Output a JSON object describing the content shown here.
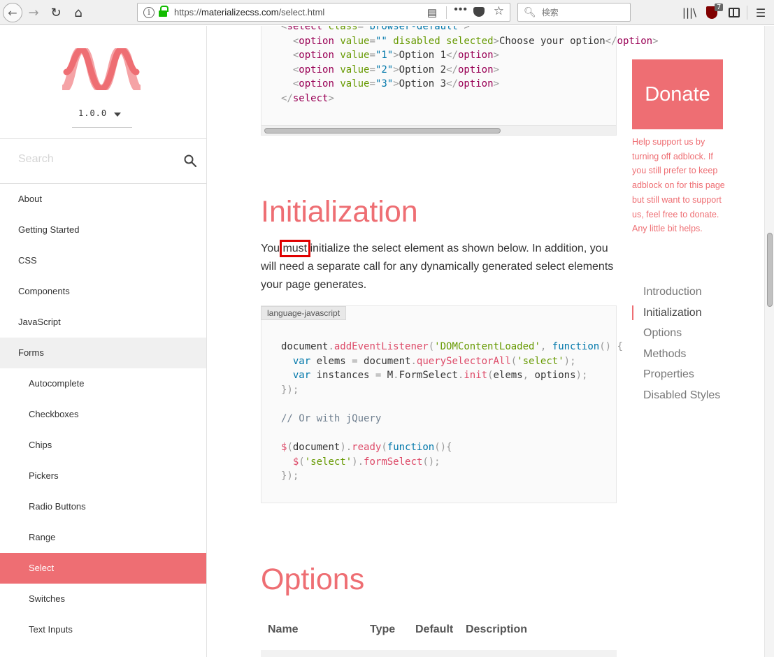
{
  "browser": {
    "url_prefix": "https://",
    "url_host": "materializecss.com",
    "url_path": "/select.html",
    "search_placeholder": "検索",
    "ublock_count": "7",
    "icons": [
      "back-arrow-icon",
      "forward-arrow-icon",
      "reload-icon",
      "home-icon",
      "info-icon",
      "lock-icon",
      "reader-view-icon",
      "more-dots-icon",
      "pocket-icon",
      "bookmark-star-icon",
      "search-icon",
      "library-icon",
      "ublock-shield-icon",
      "sidebar-icon",
      "hamburger-menu-icon"
    ]
  },
  "sidebar": {
    "version": "1.0.0",
    "search_placeholder": "Search",
    "items": [
      {
        "label": "About"
      },
      {
        "label": "Getting Started"
      },
      {
        "label": "CSS"
      },
      {
        "label": "Components"
      },
      {
        "label": "JavaScript"
      },
      {
        "label": "Forms"
      }
    ],
    "forms_sub": [
      {
        "label": "Autocomplete"
      },
      {
        "label": "Checkboxes"
      },
      {
        "label": "Chips"
      },
      {
        "label": "Pickers"
      },
      {
        "label": "Radio Buttons"
      },
      {
        "label": "Range"
      },
      {
        "label": "Select"
      },
      {
        "label": "Switches"
      },
      {
        "label": "Text Inputs"
      }
    ],
    "active_item": "Select",
    "accent_color": "#ee6e73"
  },
  "main": {
    "html_code_lines": [
      "<select class=\"browser-default\">",
      "  <option value=\"\" disabled selected>Choose your option</option>",
      "  <option value=\"1\">Option 1</option>",
      "  <option value=\"2\">Option 2</option>",
      "  <option value=\"3\">Option 3</option>",
      "</select>"
    ],
    "init_heading": "Initialization",
    "init_para_before": "You ",
    "init_para_highlight": "must",
    "init_para_after": " initialize the select element as shown below. In addition, you will need a separate call for any dynamically generated select elements your page generates.",
    "code_lang": "language-javascript",
    "js_code_lines": [
      "document.addEventListener('DOMContentLoaded', function() {",
      "  var elems = document.querySelectorAll('select');",
      "  var instances = M.FormSelect.init(elems, options);",
      "});",
      "",
      "// Or with jQuery",
      "",
      "$(document).ready(function(){",
      "  $('select').formSelect();",
      "});"
    ],
    "options_heading": "Options",
    "table_headers": [
      "Name",
      "Type",
      "Default",
      "Description"
    ]
  },
  "right_rail": {
    "donate_label": "Donate",
    "donate_text": "Help support us by turning off adblock. If you still prefer to keep adblock on for this page but still want to support us, feel free to donate. Any little bit helps.",
    "toc": [
      "Introduction",
      "Initialization",
      "Options",
      "Methods",
      "Properties",
      "Disabled Styles"
    ],
    "toc_active": "Initialization"
  }
}
